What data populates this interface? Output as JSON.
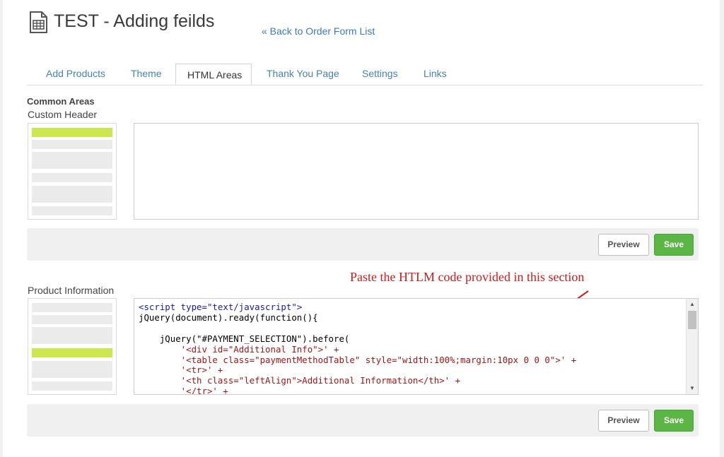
{
  "page": {
    "title": "TEST - Adding feilds",
    "title_icon": "order-form-icon",
    "back_link": "« Back to Order Form List"
  },
  "tabs": [
    {
      "label": "Add Products",
      "active": false
    },
    {
      "label": "Theme",
      "active": false
    },
    {
      "label": "HTML Areas",
      "active": true
    },
    {
      "label": "Thank You Page",
      "active": false
    },
    {
      "label": "Settings",
      "active": false
    },
    {
      "label": "Links",
      "active": false
    }
  ],
  "common_areas": {
    "heading": "Common Areas",
    "custom_header": {
      "label": "Custom Header",
      "value": "",
      "preview_label": "Preview",
      "save_label": "Save"
    },
    "product_information": {
      "label": "Product Information",
      "preview_label": "Preview",
      "save_label": "Save",
      "code_lines": [
        "<script type=\"text/javascript\">",
        "jQuery(document).ready(function(){",
        "",
        "    jQuery(\"#PAYMENT_SELECTION\").before(",
        "        '<div id=\"Additional Info\">' +",
        "        '<table class=\"paymentMethodTable\" style=\"width:100%;margin:10px 0 0 0\">' +",
        "        '<tr>' +",
        "        '<th class=\"leftAlign\">Additional Information</th>' +",
        "        '</tr>' +"
      ]
    }
  },
  "annotation": {
    "text": "Paste the HTLM code provided in this section",
    "color": "#d01c1c"
  },
  "colors": {
    "accent_link": "#3d7ab8",
    "save_green": "#5cb646",
    "highlight_block": "#cde74f"
  }
}
